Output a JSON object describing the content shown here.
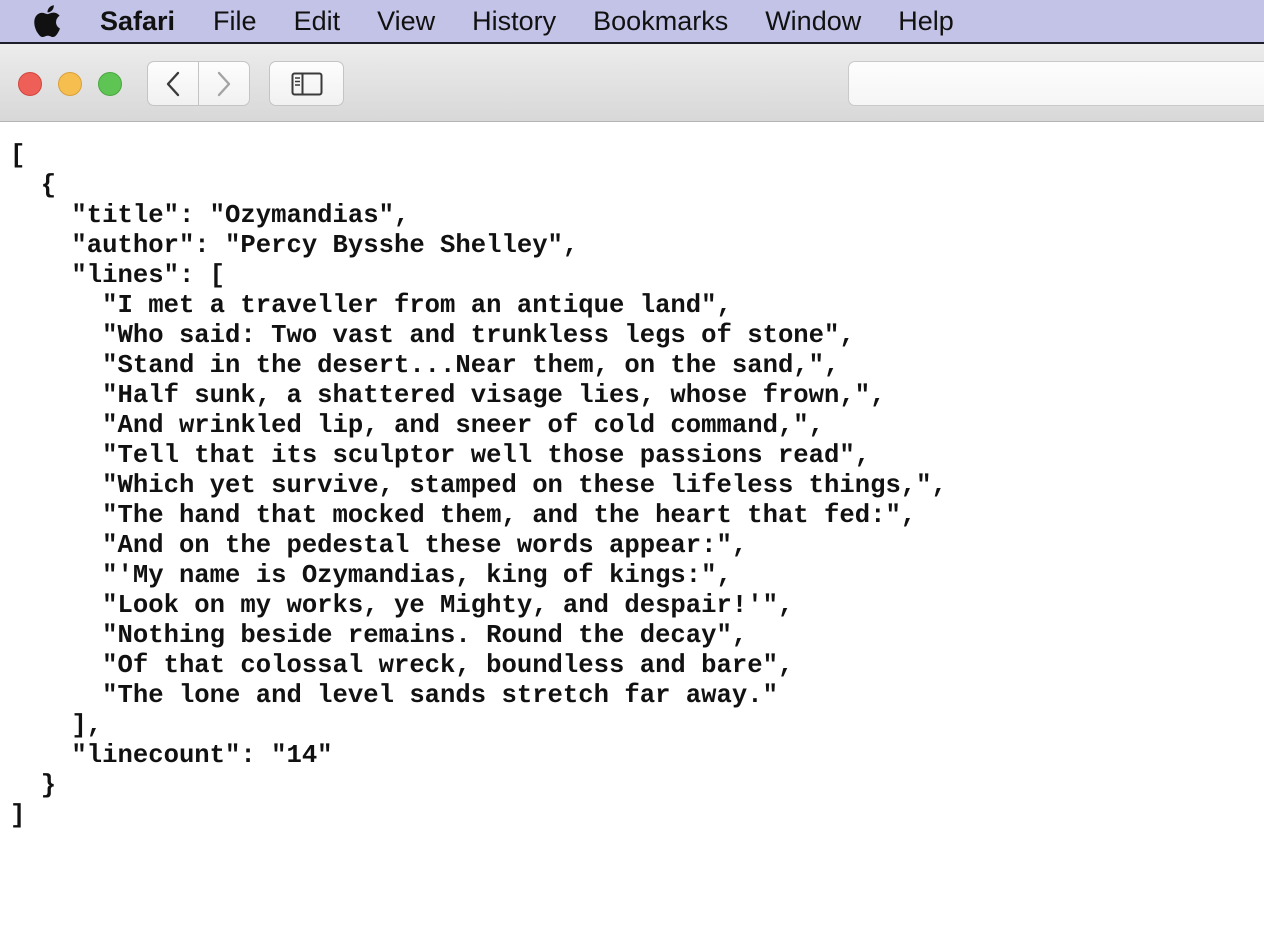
{
  "menubar": {
    "app_name": "Safari",
    "items": [
      "File",
      "Edit",
      "View",
      "History",
      "Bookmarks",
      "Window",
      "Help"
    ]
  },
  "toolbar": {
    "address_value": ""
  },
  "page": {
    "lines": [
      "[",
      "  {",
      "    \"title\": \"Ozymandias\",",
      "    \"author\": \"Percy Bysshe Shelley\",",
      "    \"lines\": [",
      "      \"I met a traveller from an antique land\",",
      "      \"Who said: Two vast and trunkless legs of stone\",",
      "      \"Stand in the desert...Near them, on the sand,\",",
      "      \"Half sunk, a shattered visage lies, whose frown,\",",
      "      \"And wrinkled lip, and sneer of cold command,\",",
      "      \"Tell that its sculptor well those passions read\",",
      "      \"Which yet survive, stamped on these lifeless things,\",",
      "      \"The hand that mocked them, and the heart that fed:\",",
      "      \"And on the pedestal these words appear:\",",
      "      \"'My name is Ozymandias, king of kings:\",",
      "      \"Look on my works, ye Mighty, and despair!'\",",
      "      \"Nothing beside remains. Round the decay\",",
      "      \"Of that colossal wreck, boundless and bare\",",
      "      \"The lone and level sands stretch far away.\"",
      "    ],",
      "    \"linecount\": \"14\"",
      "  }",
      "]"
    ]
  }
}
